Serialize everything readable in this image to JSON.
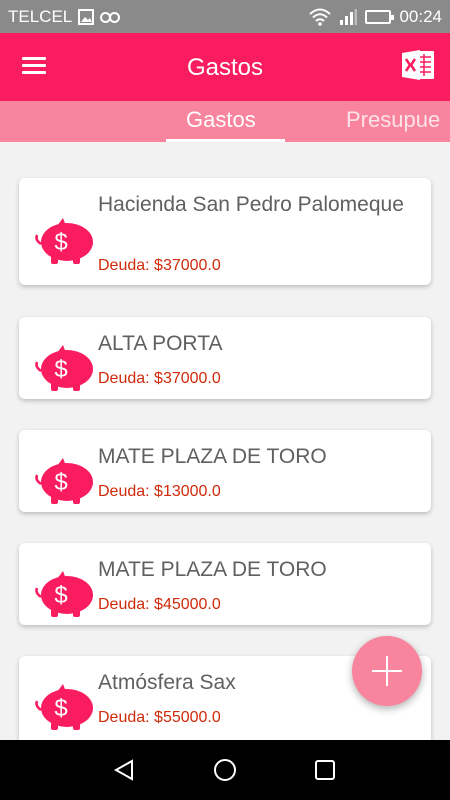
{
  "status_bar": {
    "carrier": "TELCEL",
    "time": "00:24"
  },
  "app_bar": {
    "title": "Gastos",
    "menu_icon": "hamburger-icon",
    "export_icon": "excel-icon"
  },
  "tabs": [
    {
      "label": "Gastos",
      "active": true
    },
    {
      "label": "Presupue",
      "active": false
    }
  ],
  "expenses": [
    {
      "title": "Hacienda San Pedro Palomeque",
      "debt": "Deuda: $37000.0"
    },
    {
      "title": "ALTA PORTA",
      "debt": "Deuda: $37000.0"
    },
    {
      "title": "MATE PLAZA DE TORO",
      "debt": "Deuda: $13000.0"
    },
    {
      "title": "MATE PLAZA DE TORO",
      "debt": "Deuda: $45000.0"
    },
    {
      "title": "Atmósfera Sax",
      "debt": "Deuda: $55000.0"
    }
  ],
  "fab": {
    "icon": "plus-icon"
  },
  "colors": {
    "primary": "#f91c5f",
    "tab_bar": "#f8849e",
    "debt_text": "#d02a0a",
    "accent": "#f8849e"
  }
}
